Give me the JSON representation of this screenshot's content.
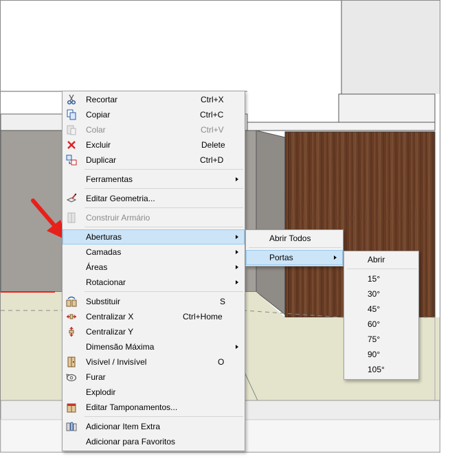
{
  "context_menu": {
    "items": [
      {
        "label": "Recortar",
        "shortcut": "Ctrl+X"
      },
      {
        "label": "Copiar",
        "shortcut": "Ctrl+C"
      },
      {
        "label": "Colar",
        "shortcut": "Ctrl+V"
      },
      {
        "label": "Excluir",
        "shortcut": "Delete"
      },
      {
        "label": "Duplicar",
        "shortcut": "Ctrl+D"
      },
      {
        "label": "Ferramentas"
      },
      {
        "label": "Editar Geometria..."
      },
      {
        "label": "Construir Armário"
      },
      {
        "label": "Aberturas"
      },
      {
        "label": "Camadas"
      },
      {
        "label": "Áreas"
      },
      {
        "label": "Rotacionar"
      },
      {
        "label": "Substituir",
        "shortcut": "S"
      },
      {
        "label": "Centralizar X",
        "shortcut": "Ctrl+Home"
      },
      {
        "label": "Centralizar Y"
      },
      {
        "label": "Dimensão Máxima"
      },
      {
        "label": "Visível / Invisível",
        "shortcut": "O"
      },
      {
        "label": "Furar"
      },
      {
        "label": "Explodir"
      },
      {
        "label": "Editar Tamponamentos..."
      },
      {
        "label": "Adicionar Item Extra"
      },
      {
        "label": "Adicionar para Favoritos"
      }
    ]
  },
  "aberturas_submenu": {
    "items": [
      {
        "label": "Abrir Todos"
      },
      {
        "label": "Portas"
      }
    ]
  },
  "portas_submenu": {
    "items": [
      {
        "label": "Abrir"
      },
      {
        "label": "15°"
      },
      {
        "label": "30°"
      },
      {
        "label": "45°"
      },
      {
        "label": "60°"
      },
      {
        "label": "75°"
      },
      {
        "label": "90°"
      },
      {
        "label": "105°"
      }
    ]
  },
  "colors": {
    "highlight": "#cce4f7",
    "wood": "#6b3f26",
    "cabinet_gray": "#a39f9b",
    "floor": "#e4e4cd",
    "arrow": "#e8201a"
  }
}
